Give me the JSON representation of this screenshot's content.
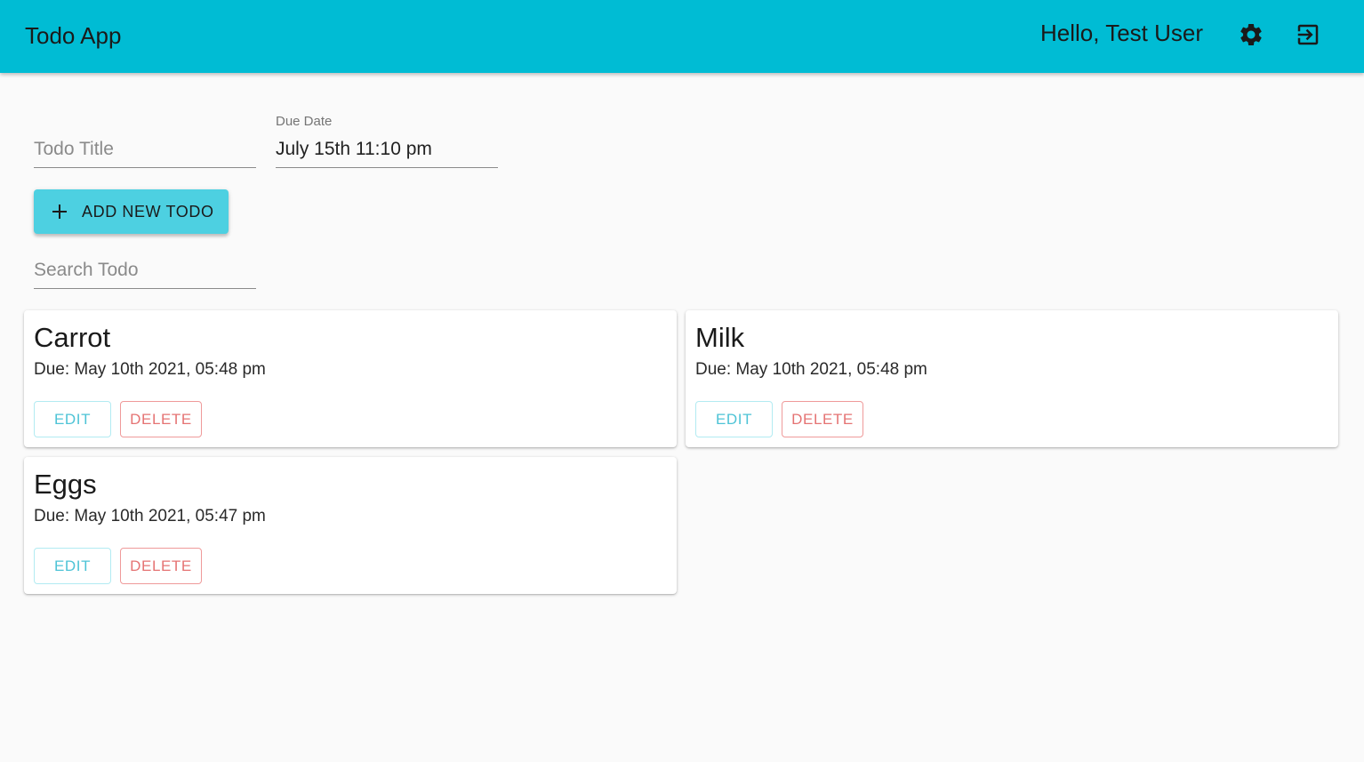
{
  "appbar": {
    "title": "Todo App",
    "greeting": "Hello, Test User",
    "color": "#00bcd4",
    "icons": [
      "gear-icon",
      "logout-icon"
    ]
  },
  "form": {
    "title_placeholder": "Todo Title",
    "title_value": "",
    "due_date_label": "Due Date",
    "due_date_value": "July 15th 11:10 pm",
    "add_button_label": "ADD NEW TODO",
    "add_button_color": "#4dd0e1",
    "search_placeholder": "Search Todo",
    "search_value": ""
  },
  "todos": [
    {
      "title": "Carrot",
      "due": "Due: May 10th 2021, 05:48 pm",
      "edit_label": "EDIT",
      "delete_label": "DELETE"
    },
    {
      "title": "Milk",
      "due": "Due: May 10th 2021, 05:48 pm",
      "edit_label": "EDIT",
      "delete_label": "DELETE"
    },
    {
      "title": "Eggs",
      "due": "Due: May 10th 2021, 05:47 pm",
      "edit_label": "EDIT",
      "delete_label": "DELETE"
    }
  ],
  "colors": {
    "edit": "#4dc3d6",
    "delete": "#e57373",
    "background": "#fafafa"
  }
}
